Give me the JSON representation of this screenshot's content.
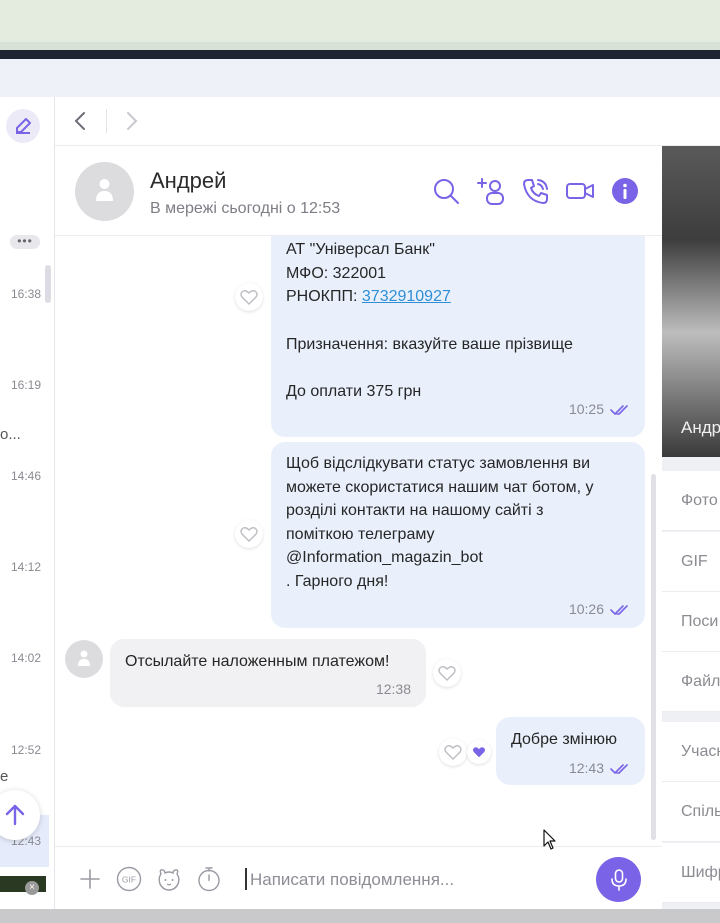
{
  "sidebar": {
    "times": [
      "16:38",
      "16:19",
      "14:46",
      "14:12",
      "14:02",
      "12:52",
      "12:43"
    ],
    "snippets": [
      "о...",
      "е"
    ],
    "menu_dots": "•••",
    "thumb_close": "×"
  },
  "chat": {
    "contact_name": "Андрей",
    "contact_status": "В мережі сьогодні о 12:53"
  },
  "messages": {
    "m1": {
      "line1": "АТ \"Універсал Банк\"",
      "line2": "МФО: 322001",
      "line3_prefix": "РНОКПП: ",
      "line3_link": "3732910927",
      "line4": "Призначення: вказуйте ваше прізвище",
      "line5": "До оплати 375 грн",
      "time": "10:25"
    },
    "m2": {
      "line1": "Щоб відслідкувати статус замовлення ви",
      "line2": "можете скористатися нашим чат ботом, у",
      "line3": "розділі контакти на нашому сайті з",
      "line4": "поміткою телеграму",
      "line5": "@Information_magazin_bot",
      "line6": ". Гарного дня!",
      "time": "10:26"
    },
    "m3": {
      "text": "Отсылайте наложенным платежом!",
      "time": "12:38"
    },
    "m4": {
      "text": "Добре змінюю",
      "time": "12:43"
    }
  },
  "composer": {
    "placeholder": "Написати повідомлення..."
  },
  "right_panel": {
    "name_partial": "Андр",
    "items": [
      "Фото",
      "GIF",
      "Поси",
      "Файл",
      "Учасн",
      "Спіль",
      "Шифр"
    ]
  },
  "colors": {
    "accent": "#7a63e6",
    "bubble_out": "#e9f0fc",
    "bubble_in": "#f1f1f3",
    "link": "#2e8fd6"
  }
}
